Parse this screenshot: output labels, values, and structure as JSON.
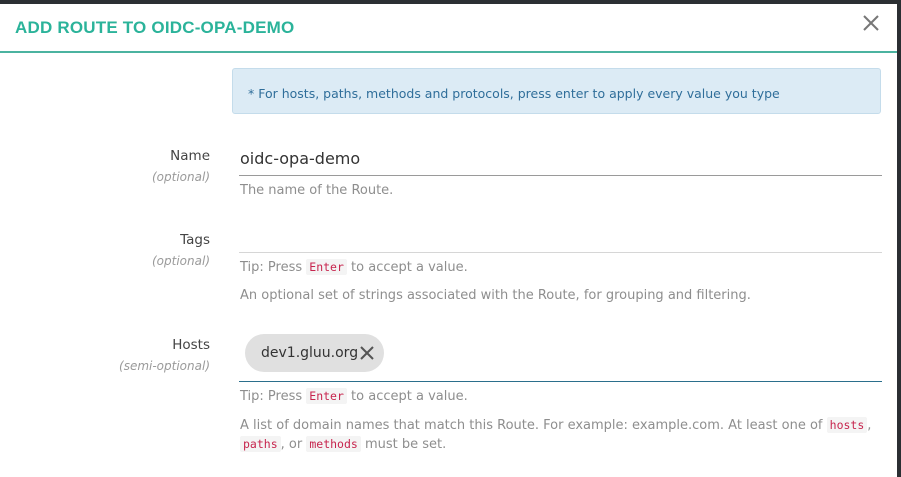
{
  "modal": {
    "title": "ADD ROUTE TO OIDC-OPA-DEMO",
    "close_icon": "close-icon",
    "info": "* For hosts, paths, methods and protocols, press enter to apply every value you type"
  },
  "fields": {
    "name": {
      "label": "Name",
      "sublabel": "(optional)",
      "value": "oidc-opa-demo",
      "help": "The name of the Route."
    },
    "tags": {
      "label": "Tags",
      "sublabel": "(optional)",
      "value": "",
      "tip_prefix": "Tip: Press",
      "tip_key": "Enter",
      "tip_suffix": "to accept a value.",
      "help": "An optional set of strings associated with the Route, for grouping and filtering."
    },
    "hosts": {
      "label": "Hosts",
      "sublabel": "(semi-optional)",
      "chips": [
        "dev1.gluu.org"
      ],
      "tip_prefix": "Tip: Press",
      "tip_key": "Enter",
      "tip_suffix": "to accept a value.",
      "help_text": "A list of domain names that match this Route. For example: example.com. At least one of",
      "help_code_1": "hosts",
      "help_sep_1": ",",
      "help_code_2": "paths",
      "help_sep_2": ", or",
      "help_code_3": "methods",
      "help_end": "must be set."
    }
  },
  "colors": {
    "title": "#2bb39a",
    "header_border": "#4bb3a0",
    "info_bg": "#dcebf5",
    "info_text": "#2f6e9a",
    "code": "#c7254e"
  }
}
